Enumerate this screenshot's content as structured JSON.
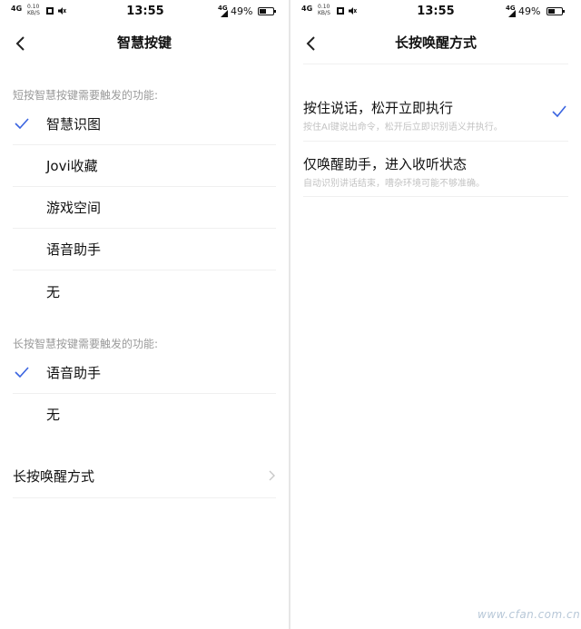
{
  "status_bar": {
    "network_left": "4G",
    "speed_value": "0.10",
    "speed_unit": "KB/S",
    "time": "13:55",
    "network_right": "4G",
    "battery": "49%",
    "battery_level": 0.49
  },
  "left_screen": {
    "title": "智慧按键",
    "short_press_label": "短按智慧按键需要触发的功能:",
    "short_press_options": [
      {
        "label": "智慧识图",
        "selected": true
      },
      {
        "label": "Jovi收藏",
        "selected": false
      },
      {
        "label": "游戏空间",
        "selected": false
      },
      {
        "label": "语音助手",
        "selected": false
      },
      {
        "label": "无",
        "selected": false
      }
    ],
    "long_press_label": "长按智慧按键需要触发的功能:",
    "long_press_options": [
      {
        "label": "语音助手",
        "selected": true
      },
      {
        "label": "无",
        "selected": false
      }
    ],
    "wake_mode_link": "长按唤醒方式"
  },
  "right_screen": {
    "title": "长按唤醒方式",
    "options": [
      {
        "title": "按住说话，松开立即执行",
        "subtitle": "按住AI键说出命令，松开后立即识别语义并执行。",
        "selected": true
      },
      {
        "title": "仅唤醒助手，进入收听状态",
        "subtitle": "自动识别讲话结束，嘈杂环境可能不够准确。",
        "selected": false
      }
    ]
  },
  "watermark": "www.cfan.com.cn",
  "colors": {
    "accent": "#3a64e0",
    "text": "#111111",
    "secondary": "#9a9a9a",
    "subtitle": "#c3c3c3"
  }
}
